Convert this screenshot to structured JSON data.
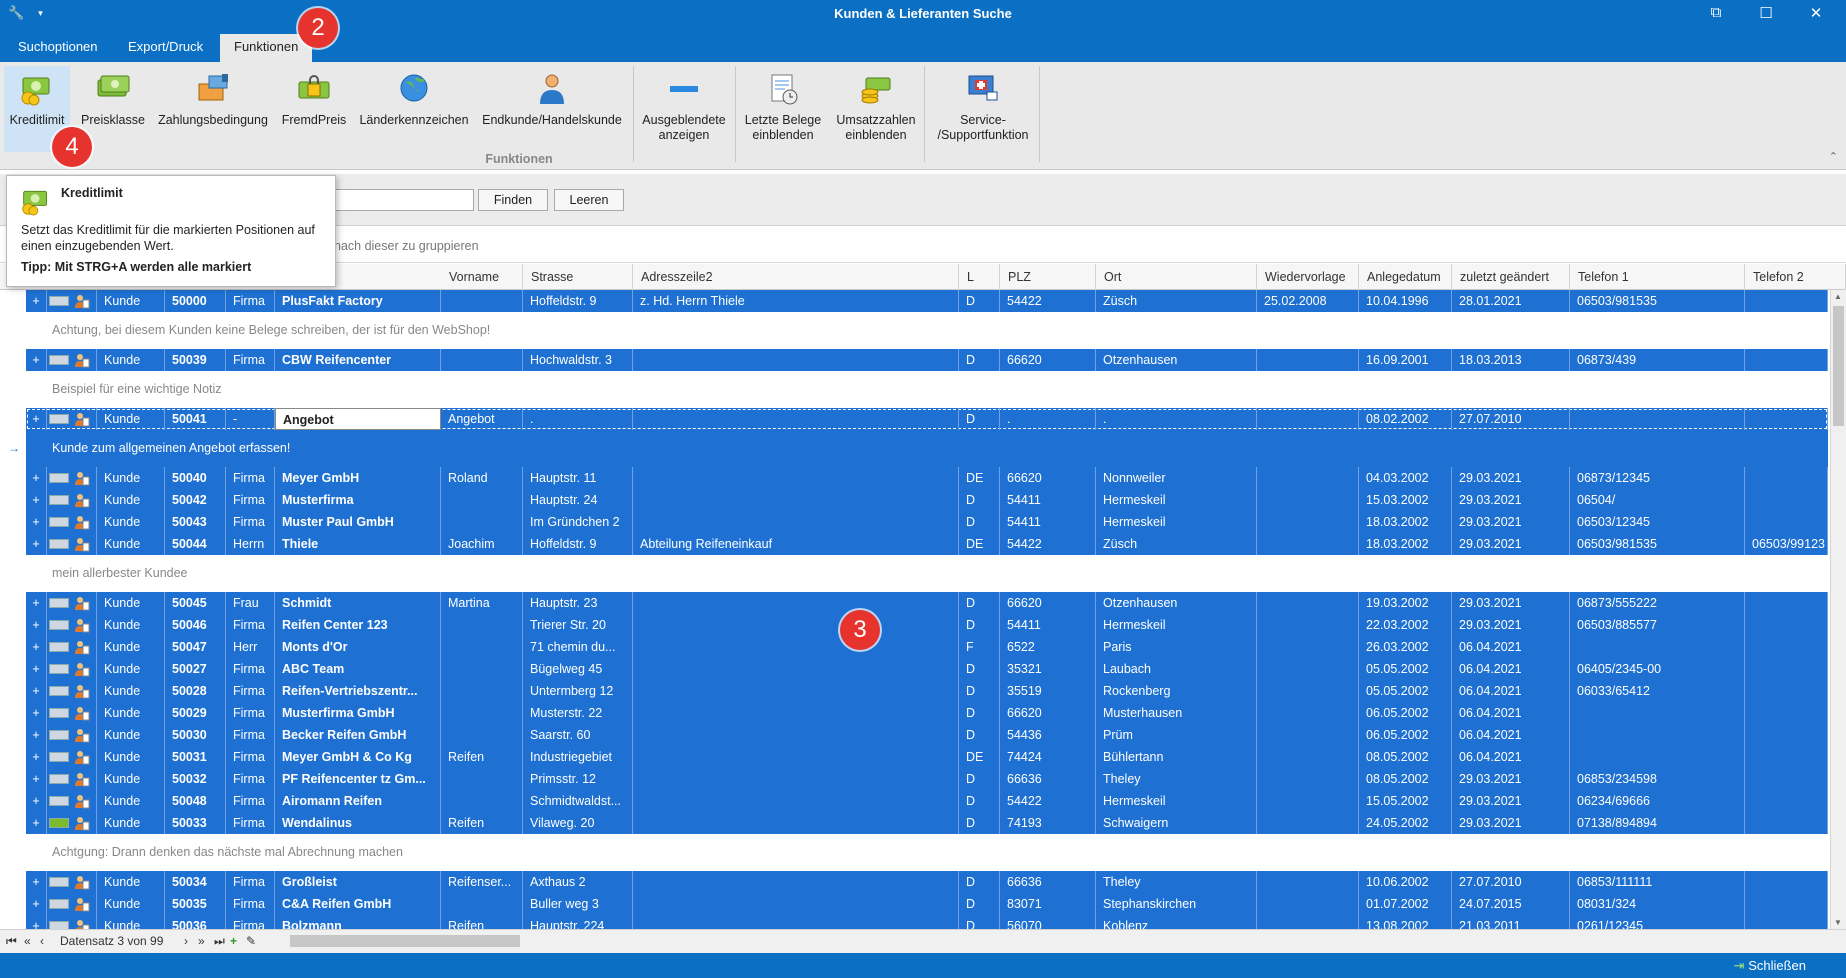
{
  "window": {
    "title": "Kunden & Lieferanten Suche",
    "controls": [
      "⧉",
      "☐",
      "✕"
    ]
  },
  "tabs": [
    {
      "label": "Suchoptionen"
    },
    {
      "label": "Export/Druck"
    },
    {
      "label": "Funktionen",
      "active": true
    }
  ],
  "callouts": {
    "tab": "2",
    "grid": "3",
    "ribbon": "4"
  },
  "ribbon": {
    "buttons": [
      {
        "label": "Kreditlimit",
        "icon": "money-coins-icon",
        "selected": true
      },
      {
        "label": "Preisklasse",
        "icon": "banknotes-icon"
      },
      {
        "label": "Zahlungsbedingung",
        "icon": "payment-terms-icon"
      },
      {
        "label": "FremdPreis",
        "icon": "money-lock-icon"
      },
      {
        "label": "Länderkennzeichen",
        "icon": "globe-icon"
      },
      {
        "label": "Endkunde/Handelskunde",
        "icon": "person-icon"
      },
      {
        "label": "Ausgeblendete\nanzeigen",
        "icon": "minus-bar-icon"
      },
      {
        "label": "Letzte Belege\neinblenden",
        "icon": "document-clock-icon"
      },
      {
        "label": "Umsatzzahlen\neinblenden",
        "icon": "money-stack-icon"
      },
      {
        "label": "Service-\n/Supportfunktion",
        "icon": "support-monitor-icon"
      }
    ],
    "group_label": "Funktionen"
  },
  "tooltip": {
    "title": "Kreditlimit",
    "description": "Setzt das Kreditlimit für die markierten Positionen auf einen einzugebenden Wert.",
    "tip": "Tipp: Mit STRG+A werden alle markiert"
  },
  "search": {
    "value": "",
    "find_label": "Finden",
    "clear_label": "Leeren"
  },
  "group_hint": "nach dieser zu gruppieren",
  "columns": [
    "Vorname",
    "Strasse",
    "Adresszeile2",
    "L",
    "PLZ",
    "Ort",
    "Wiedervorlage",
    "Anlegedatum",
    "zuletzt geändert",
    "Telefon 1",
    "Telefon 2"
  ],
  "rows": [
    {
      "type": "Kunde",
      "nr": "50000",
      "anrede": "Firma",
      "name": "PlusFakt Factory",
      "vorname": "",
      "strasse": "Hoffeldstr. 9",
      "adr2": "z. Hd. Herrn Thiele",
      "land": "D",
      "plz": "54422",
      "ort": "Züsch",
      "wv": "25.02.2008",
      "angelegt": "10.04.1996",
      "geaendert": "28.01.2021",
      "tel1": "06503/981535",
      "tel2": "",
      "note": "Achtung, bei diesem Kunden keine Belege schreiben, der ist für den WebShop!"
    },
    {
      "type": "Kunde",
      "nr": "50039",
      "anrede": "Firma",
      "name": "CBW Reifencenter",
      "vorname": "",
      "strasse": "Hochwaldstr. 3",
      "adr2": "",
      "land": "D",
      "plz": "66620",
      "ort": "Otzenhausen",
      "wv": "",
      "angelegt": "16.09.2001",
      "geaendert": "18.03.2013",
      "tel1": "06873/439",
      "tel2": "",
      "note": "Beispiel für eine wichtige Notiz"
    },
    {
      "type": "Kunde",
      "nr": "50041",
      "anrede": "-",
      "name": "Angebot",
      "vorname": "Angebot",
      "strasse": ".",
      "adr2": "",
      "land": "D",
      "plz": ".",
      "ort": ".",
      "wv": "",
      "angelegt": "08.02.2002",
      "geaendert": "27.07.2010",
      "tel1": "",
      "tel2": "",
      "note": "Kunde zum allgemeinen Angebot erfassen!",
      "active": true
    },
    {
      "type": "Kunde",
      "nr": "50040",
      "anrede": "Firma",
      "name": "Meyer GmbH",
      "vorname": "Roland",
      "strasse": "Hauptstr. 11",
      "adr2": "",
      "land": "DE",
      "plz": "66620",
      "ort": "Nonnweiler",
      "wv": "",
      "angelegt": "04.03.2002",
      "geaendert": "29.03.2021",
      "tel1": "06873/12345",
      "tel2": ""
    },
    {
      "type": "Kunde",
      "nr": "50042",
      "anrede": "Firma",
      "name": "Musterfirma",
      "vorname": "",
      "strasse": "Hauptstr. 24",
      "adr2": "",
      "land": "D",
      "plz": "54411",
      "ort": "Hermeskeil",
      "wv": "",
      "angelegt": "15.03.2002",
      "geaendert": "29.03.2021",
      "tel1": "06504/",
      "tel2": ""
    },
    {
      "type": "Kunde",
      "nr": "50043",
      "anrede": "Firma",
      "name": "Muster Paul GmbH",
      "vorname": "",
      "strasse": "Im Gründchen 2",
      "adr2": "",
      "land": "D",
      "plz": "54411",
      "ort": "Hermeskeil",
      "wv": "",
      "angelegt": "18.03.2002",
      "geaendert": "29.03.2021",
      "tel1": "06503/12345",
      "tel2": ""
    },
    {
      "type": "Kunde",
      "nr": "50044",
      "anrede": "Herrn",
      "name": "Thiele",
      "vorname": "Joachim",
      "strasse": "Hoffeldstr. 9",
      "adr2": "Abteilung Reifeneinkauf",
      "land": "DE",
      "plz": "54422",
      "ort": "Züsch",
      "wv": "",
      "angelegt": "18.03.2002",
      "geaendert": "29.03.2021",
      "tel1": "06503/981535",
      "tel2": "06503/99123",
      "note": "mein allerbester Kundee"
    },
    {
      "type": "Kunde",
      "nr": "50045",
      "anrede": "Frau",
      "name": "Schmidt",
      "vorname": "Martina",
      "strasse": "Hauptstr. 23",
      "adr2": "",
      "land": "D",
      "plz": "66620",
      "ort": "Otzenhausen",
      "wv": "",
      "angelegt": "19.03.2002",
      "geaendert": "29.03.2021",
      "tel1": "06873/555222",
      "tel2": ""
    },
    {
      "type": "Kunde",
      "nr": "50046",
      "anrede": "Firma",
      "name": "Reifen Center 123",
      "vorname": "",
      "strasse": "Trierer Str. 20",
      "adr2": "",
      "land": "D",
      "plz": "54411",
      "ort": "Hermeskeil",
      "wv": "",
      "angelegt": "22.03.2002",
      "geaendert": "29.03.2021",
      "tel1": "06503/885577",
      "tel2": ""
    },
    {
      "type": "Kunde",
      "nr": "50047",
      "anrede": "Herr",
      "name": "Monts d'Or",
      "vorname": "",
      "strasse": "71 chemin du...",
      "adr2": "",
      "land": "F",
      "plz": "6522",
      "ort": "Paris",
      "wv": "",
      "angelegt": "26.03.2002",
      "geaendert": "06.04.2021",
      "tel1": "",
      "tel2": ""
    },
    {
      "type": "Kunde",
      "nr": "50027",
      "anrede": "Firma",
      "name": "ABC Team",
      "vorname": "",
      "strasse": "Bügelweg 45",
      "adr2": "",
      "land": "D",
      "plz": "35321",
      "ort": "Laubach",
      "wv": "",
      "angelegt": "05.05.2002",
      "geaendert": "06.04.2021",
      "tel1": "06405/2345-00",
      "tel2": ""
    },
    {
      "type": "Kunde",
      "nr": "50028",
      "anrede": "Firma",
      "name": "Reifen-Vertriebszentr...",
      "vorname": "",
      "strasse": "Untermberg 12",
      "adr2": "",
      "land": "D",
      "plz": "35519",
      "ort": "Rockenberg",
      "wv": "",
      "angelegt": "05.05.2002",
      "geaendert": "06.04.2021",
      "tel1": "06033/65412",
      "tel2": ""
    },
    {
      "type": "Kunde",
      "nr": "50029",
      "anrede": "Firma",
      "name": "Musterfirma GmbH",
      "vorname": "",
      "strasse": "Musterstr. 22",
      "adr2": "",
      "land": "D",
      "plz": "66620",
      "ort": "Musterhausen",
      "wv": "",
      "angelegt": "06.05.2002",
      "geaendert": "06.04.2021",
      "tel1": "",
      "tel2": ""
    },
    {
      "type": "Kunde",
      "nr": "50030",
      "anrede": "Firma",
      "name": "Becker Reifen GmbH",
      "vorname": "",
      "strasse": "Saarstr. 60",
      "adr2": "",
      "land": "D",
      "plz": "54436",
      "ort": "Prüm",
      "wv": "",
      "angelegt": "06.05.2002",
      "geaendert": "06.04.2021",
      "tel1": "",
      "tel2": ""
    },
    {
      "type": "Kunde",
      "nr": "50031",
      "anrede": "Firma",
      "name": "Meyer GmbH & Co Kg",
      "vorname": "Reifen",
      "strasse": "Industriegebiet",
      "adr2": "",
      "land": "DE",
      "plz": "74424",
      "ort": "Bühlertann",
      "wv": "",
      "angelegt": "08.05.2002",
      "geaendert": "06.04.2021",
      "tel1": "",
      "tel2": ""
    },
    {
      "type": "Kunde",
      "nr": "50032",
      "anrede": "Firma",
      "name": "PF Reifencenter tz Gm...",
      "vorname": "",
      "strasse": "Primsstr. 12",
      "adr2": "",
      "land": "D",
      "plz": "66636",
      "ort": "Theley",
      "wv": "",
      "angelegt": "08.05.2002",
      "geaendert": "29.03.2021",
      "tel1": "06853/234598",
      "tel2": ""
    },
    {
      "type": "Kunde",
      "nr": "50048",
      "anrede": "Firma",
      "name": "Airomann Reifen",
      "vorname": "",
      "strasse": "Schmidtwaldst...",
      "adr2": "",
      "land": "D",
      "plz": "54422",
      "ort": "Hermeskeil",
      "wv": "",
      "angelegt": "15.05.2002",
      "geaendert": "29.03.2021",
      "tel1": "06234/69666",
      "tel2": ""
    },
    {
      "type": "Kunde",
      "nr": "50033",
      "anrede": "Firma",
      "name": "Wendalinus",
      "vorname": "Reifen",
      "strasse": "Vilaweg. 20",
      "adr2": "",
      "land": "D",
      "plz": "74193",
      "ort": "Schwaigern",
      "wv": "",
      "angelegt": "24.05.2002",
      "geaendert": "29.03.2021",
      "tel1": "07138/894894",
      "tel2": "",
      "green": true,
      "note": "Achtgung: Drann denken das nächste mal Abrechnung machen"
    },
    {
      "type": "Kunde",
      "nr": "50034",
      "anrede": "Firma",
      "name": "Großleist",
      "vorname": "Reifenser...",
      "strasse": "Axthaus 2",
      "adr2": "",
      "land": "D",
      "plz": "66636",
      "ort": "Theley",
      "wv": "",
      "angelegt": "10.06.2002",
      "geaendert": "27.07.2010",
      "tel1": "06853/111111",
      "tel2": ""
    },
    {
      "type": "Kunde",
      "nr": "50035",
      "anrede": "Firma",
      "name": "C&A Reifen GmbH",
      "vorname": "",
      "strasse": "Buller weg 3",
      "adr2": "",
      "land": "D",
      "plz": "83071",
      "ort": "Stephanskirchen",
      "wv": "",
      "angelegt": "01.07.2002",
      "geaendert": "24.07.2015",
      "tel1": "08031/324",
      "tel2": ""
    },
    {
      "type": "Kunde",
      "nr": "50036",
      "anrede": "Firma",
      "name": "Bolzmann",
      "vorname": "Reifen",
      "strasse": "Hauptstr. 224",
      "adr2": "",
      "land": "D",
      "plz": "56070",
      "ort": "Koblenz",
      "wv": "",
      "angelegt": "13.08.2002",
      "geaendert": "21.03.2011",
      "tel1": "0261/12345",
      "tel2": ""
    }
  ],
  "navigator": {
    "record_text": "Datensatz 3 von 99",
    "first": "⏮",
    "prev_page": "«",
    "prev": "‹",
    "next": "›",
    "next_page": "»",
    "last": "⏭",
    "add": "+",
    "edit": "✎"
  },
  "status": {
    "close_label": "Schließen"
  }
}
